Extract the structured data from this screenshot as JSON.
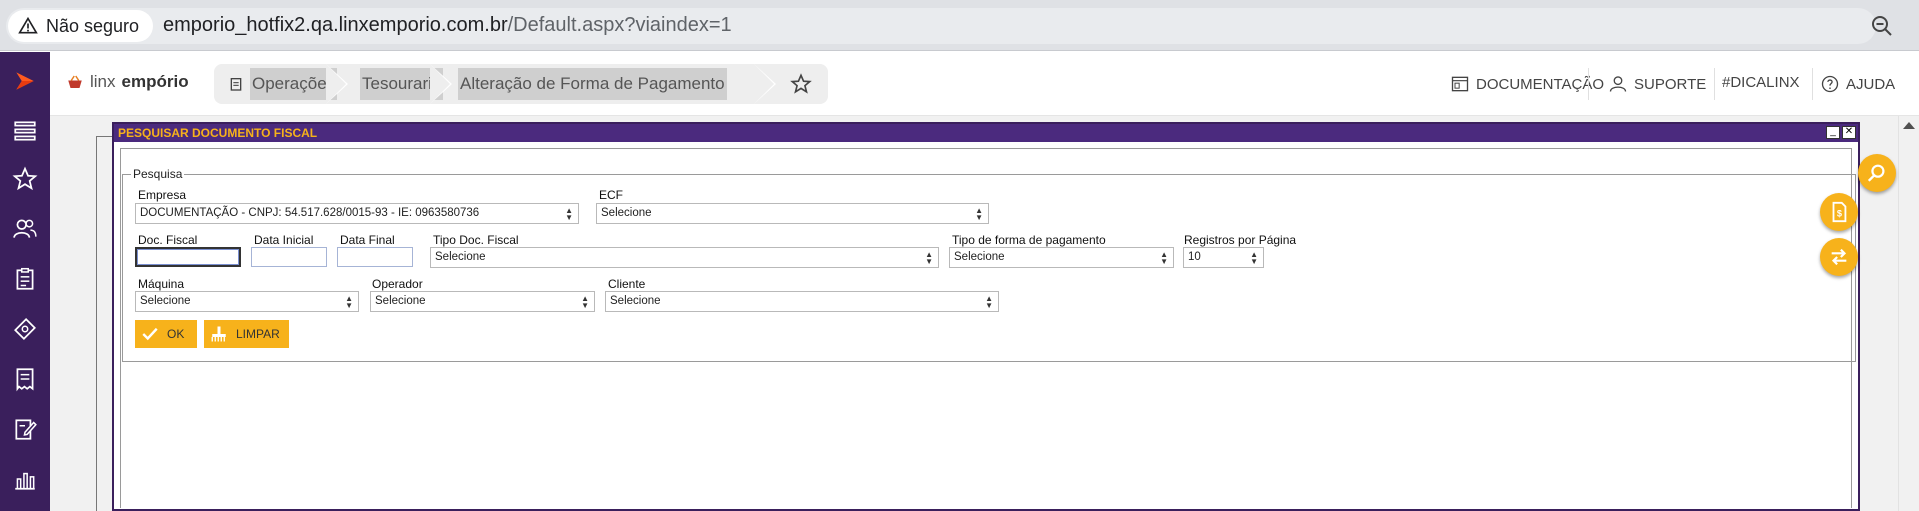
{
  "browser": {
    "security_label": "Não seguro",
    "url_host": "emporio_hotfix2.qa.linxemporio.com.br",
    "url_path": "/Default.aspx?viaindex=1"
  },
  "header": {
    "logo_light": "linx",
    "logo_bold": "empório",
    "breadcrumbs": [
      "Operações",
      "Tesouraria",
      "Alteração de Forma de Pagamento"
    ],
    "links": {
      "documentacao": "DOCUMENTAÇÃO",
      "suporte": "SUPORTE",
      "dicalinx": "#DICALINX",
      "ajuda": "AJUDA"
    }
  },
  "modal": {
    "title": "PESQUISAR DOCUMENTO FISCAL",
    "minimize_glyph": "_",
    "close_glyph": "✕",
    "fieldset_legend": "Pesquisa",
    "fields": {
      "empresa_label": "Empresa",
      "empresa_value": "DOCUMENTAÇÃO - CNPJ: 54.517.628/0015-93 - IE: 0963580736",
      "ecf_label": "ECF",
      "ecf_value": "Selecione",
      "doc_fiscal_label": "Doc. Fiscal",
      "data_inicial_label": "Data Inicial",
      "data_final_label": "Data Final",
      "tipo_doc_label": "Tipo Doc. Fiscal",
      "tipo_doc_value": "Selecione",
      "tipo_forma_label": "Tipo de forma de pagamento",
      "tipo_forma_value": "Selecione",
      "registros_label": "Registros por Página",
      "registros_value": "10",
      "maquina_label": "Máquina",
      "maquina_value": "Selecione",
      "operador_label": "Operador",
      "operador_value": "Selecione",
      "cliente_label": "Cliente",
      "cliente_value": "Selecione"
    },
    "buttons": {
      "ok": "OK",
      "limpar": "LIMPAR"
    }
  },
  "colors": {
    "rail": "#3a1f5c",
    "modal_title_bg": "#4b2a7e",
    "accent": "#f7b21b"
  }
}
